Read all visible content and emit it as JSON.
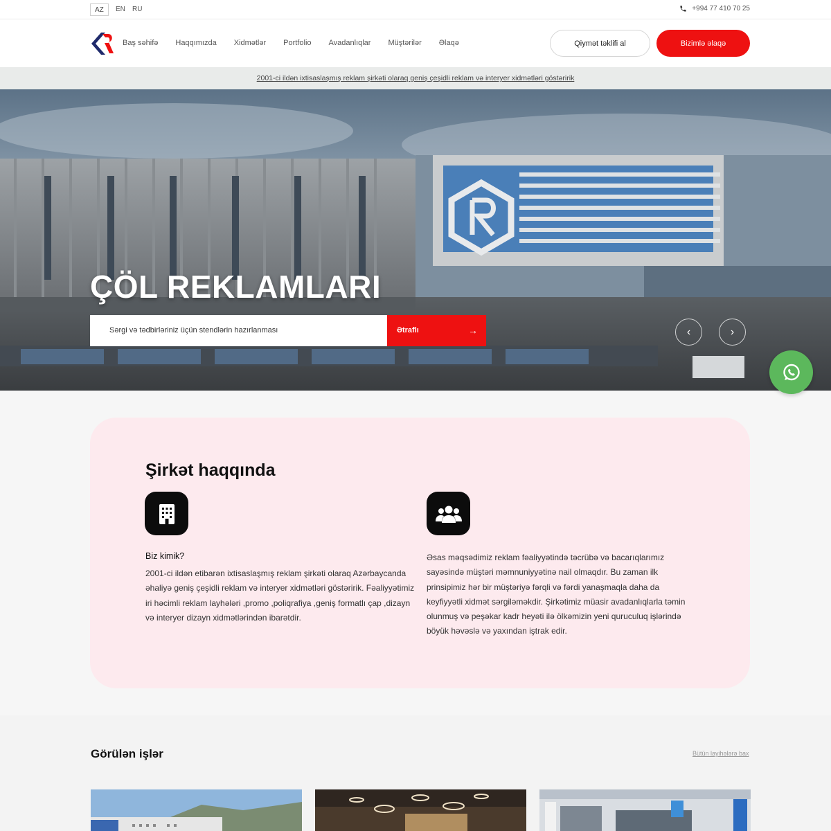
{
  "topbar": {
    "languages": [
      {
        "code": "AZ",
        "active": true
      },
      {
        "code": "EN",
        "active": false
      },
      {
        "code": "RU",
        "active": false
      }
    ],
    "phone": "+994 77 410 70 25"
  },
  "header": {
    "nav": [
      {
        "label": "Baş səhifə"
      },
      {
        "label": "Haqqımızda"
      },
      {
        "label": "Xidmətlər"
      },
      {
        "label": "Portfolio"
      },
      {
        "label": "Avadanlıqlar"
      },
      {
        "label": "Müştərilər"
      },
      {
        "label": "Əlaqə"
      }
    ],
    "quote_button": "Qiymət təklifi al",
    "contact_button": "Bizimlə əlaqə"
  },
  "strip": {
    "text": "2001-ci ildən ixtisaslaşmış reklam şirkəti olaraq geniş çeşidli reklam və interyer xidmətləri göstəririk"
  },
  "hero": {
    "title": "ÇÖL REKLAMLARI",
    "subtitle": "Sərgi və tədbirləriniz üçün stendlərin hazırlanması",
    "more_button": "Ətraflı",
    "arrow": "→",
    "prev": "‹",
    "next": "›"
  },
  "about": {
    "title": "Şirkət haqqında",
    "who_title": "Biz kimik?",
    "who_text": "2001-ci ildən etibarən ixtisaslaşmış reklam şirkəti olaraq Azərbaycanda əhaliyə geniş çeşidli reklam və interyer xidmətləri göstəririk. Fəaliyyətimiz iri həcimli reklam layhələri ,promo ,poliqrafiya ,geniş formatlı çap ,dizayn və interyer dizayn xidmətlərindən ibarətdir.",
    "mission_text": "Əsas məqsədimiz reklam fəaliyyətində təcrübə və bacarıqlarımız sayəsində müştəri məmnuniyyətinə nail olmaqdır. Bu zaman ilk prinsipimiz hər bir müştəriyə fərqli və fərdi yanaşmaqla daha da keyfiyyətli xidmət sərgiləməkdir. Şirkətimiz müasir avadanlıqlarla təmin olunmuş və peşəkar kadr heyəti ilə ölkəmizin yeni quruculuq işlərində böyük həvəslə və yaxından iştrak edir."
  },
  "works": {
    "title": "Görülən işlər",
    "all_link": "Bütün layihələrə bax"
  },
  "colors": {
    "accent": "#ee1111",
    "about_bg": "#fdeaee",
    "whatsapp": "#5cb85c",
    "logo_blue": "#1f2a6b"
  },
  "icons": [
    "phone-icon",
    "logo-icon",
    "building-icon",
    "users-icon",
    "whatsapp-icon",
    "arrow-right-icon",
    "chevron-left-icon",
    "chevron-right-icon"
  ]
}
